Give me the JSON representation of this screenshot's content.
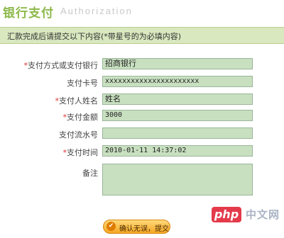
{
  "header": {
    "title": "银行支付",
    "subtitle": "Authorization"
  },
  "notice": "汇款完成后请提交以下内容(*带星号的为必填内容)",
  "form": {
    "fields": [
      {
        "label": "支付方式或支付银行",
        "required": true,
        "value": "招商银行"
      },
      {
        "label": "支付卡号",
        "required": false,
        "value": "xxxxxxxxxxxxxxxxxxxxxx"
      },
      {
        "label": "支付人姓名",
        "required": true,
        "value": "姓名"
      },
      {
        "label": "支付金额",
        "required": true,
        "value": "3000"
      },
      {
        "label": "支付流水号",
        "required": false,
        "value": ""
      },
      {
        "label": "支付时间",
        "required": true,
        "value": "2010-01-11 14:37:02"
      }
    ],
    "remark_label": "备注",
    "required_mark": "*"
  },
  "submit_label": "确认无误，提交",
  "submit_icon": "✔",
  "watermark": {
    "pill": "php",
    "text": "中文网"
  },
  "colors": {
    "title": "#8cb84a",
    "notice_bg": "#d9e8bf",
    "field_bg": "#c8e0c0",
    "required": "#e03030",
    "submit": "#f5a623"
  }
}
